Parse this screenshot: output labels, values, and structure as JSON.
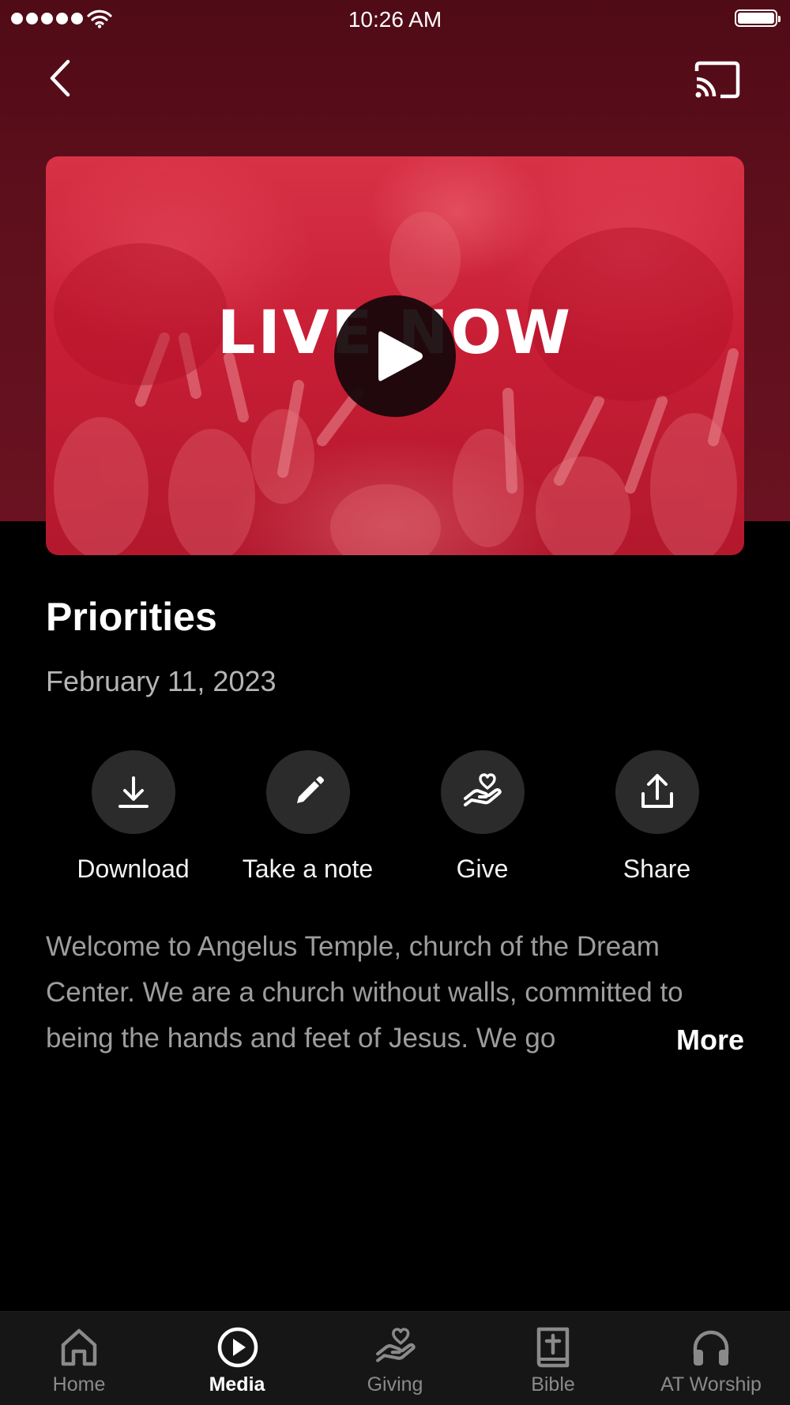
{
  "status_bar": {
    "time": "10:26 AM"
  },
  "video": {
    "overlay_text": "LIVE NOW"
  },
  "sermon": {
    "title": "Priorities",
    "date": "February 11, 2023",
    "description": "Welcome to Angelus Temple, church of the Dream Center. We are a church without walls, committed to being the hands and feet of Jesus. We go",
    "more_label": "More"
  },
  "actions": [
    {
      "label": "Download",
      "icon": "download-icon"
    },
    {
      "label": "Take a note",
      "icon": "pencil-icon"
    },
    {
      "label": "Give",
      "icon": "heart-hand-icon"
    },
    {
      "label": "Share",
      "icon": "share-icon"
    }
  ],
  "tabs": [
    {
      "label": "Home",
      "icon": "home-icon",
      "active": false
    },
    {
      "label": "Media",
      "icon": "play-circle-icon",
      "active": true
    },
    {
      "label": "Giving",
      "icon": "heart-hand-icon",
      "active": false
    },
    {
      "label": "Bible",
      "icon": "bible-icon",
      "active": false
    },
    {
      "label": "AT Worship",
      "icon": "headphones-icon",
      "active": false
    }
  ],
  "colors": {
    "header_bg": "#5e0f1c",
    "video_tint": "#c81e36",
    "background": "#000000",
    "tab_bar_bg": "#161616",
    "action_circle": "#2b2b2b"
  }
}
